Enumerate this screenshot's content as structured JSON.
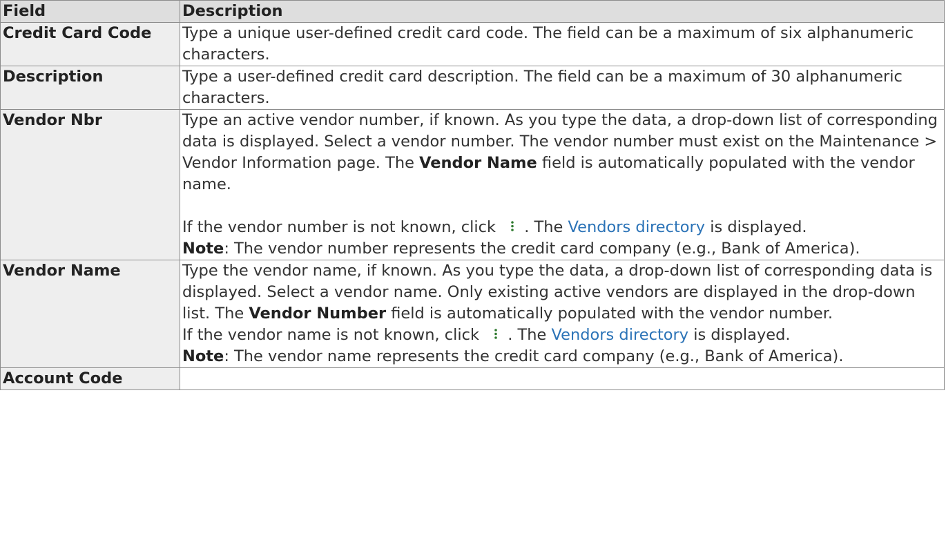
{
  "table": {
    "headers": {
      "field": "Field",
      "description": "Description"
    },
    "rows": {
      "credit_card_code": {
        "name": "Credit Card Code",
        "desc": "Type a unique user-defined credit card code. The field can be a maximum of six alphanumeric characters."
      },
      "description": {
        "name": "Description",
        "desc": "Type a user-defined credit card description. The field can be a maximum of 30 alphanumeric characters."
      },
      "vendor_nbr": {
        "name": "Vendor Nbr",
        "p1_before": "Type an active vendor number, if known. As you type the data, a drop-down list of corresponding data is displayed. Select a vendor number. The vendor number must exist on the Maintenance > Vendor Information page. The ",
        "p1_bold": "Vendor Name",
        "p1_after": " field is automatically populated with the vendor name.",
        "p2_before": "If the vendor number is not known, click ",
        "p2_middle": ". The ",
        "p2_link": "Vendors directory",
        "p2_after": " is displayed.",
        "note_label": "Note",
        "note_text": ": The vendor number represents the credit card company (e.g., Bank of America)."
      },
      "vendor_name": {
        "name": "Vendor Name",
        "p1_before": "Type the vendor name, if known. As you type the data, a drop-down list of corresponding data is displayed. Select a vendor name. Only existing active vendors are displayed in the drop-down list. The ",
        "p1_bold": "Vendor Number",
        "p1_after": " field is automatically populated with the vendor number.",
        "p2_before": "If the vendor name is not known, click ",
        "p2_middle": ". The ",
        "p2_link": "Vendors directory",
        "p2_after": " is displayed.",
        "note_label": "Note",
        "note_text": ": The vendor name represents the credit card company (e.g., Bank of America)."
      },
      "account_code": {
        "name": "Account Code",
        "desc": ""
      }
    }
  },
  "icons": {
    "directory": "vertical-dots-icon"
  },
  "colors": {
    "link": "#2b73b7",
    "header_bg": "#dedede",
    "field_bg": "#eeeeee",
    "border": "#8c8c8c"
  }
}
